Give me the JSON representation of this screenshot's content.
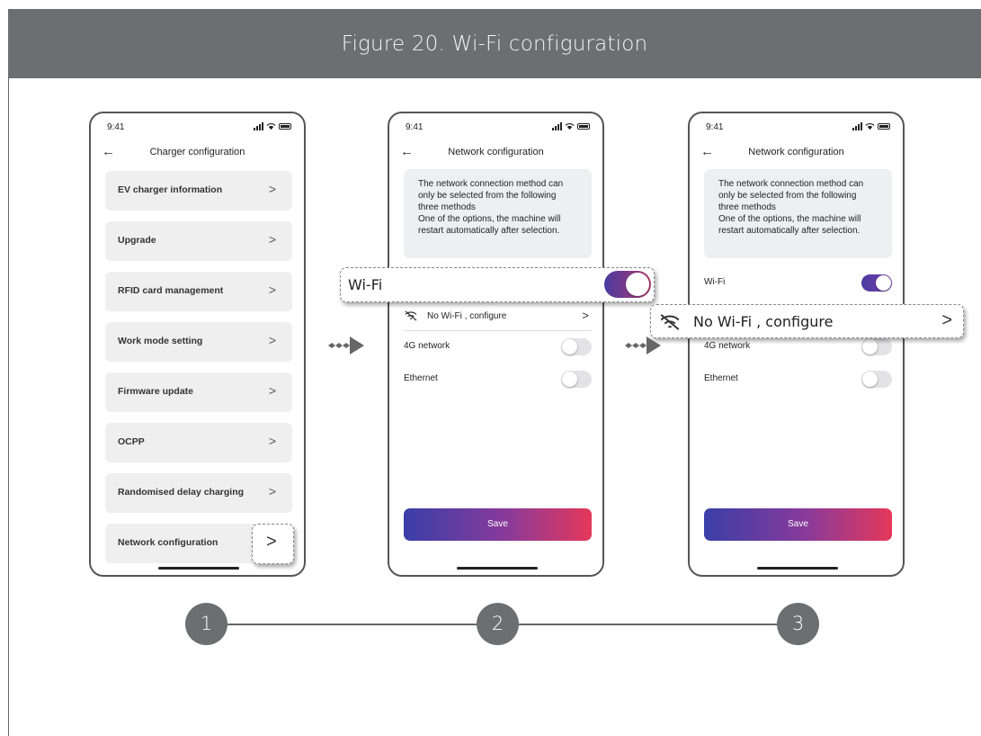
{
  "figure_title": "Figure 20.  Wi-Fi configuration",
  "status": {
    "time": "9:41"
  },
  "back_glyph": "←",
  "phone1": {
    "title": "Charger configuration",
    "items": [
      {
        "label": "EV charger information"
      },
      {
        "label": "Upgrade"
      },
      {
        "label": "RFID card management"
      },
      {
        "label": "Work mode setting"
      },
      {
        "label": "Firmware update"
      },
      {
        "label": "OCPP"
      },
      {
        "label": "Randomised delay charging"
      },
      {
        "label": "Network configuration"
      }
    ],
    "chevron": ">"
  },
  "network": {
    "title": "Network configuration",
    "info_lines": [
      "The network connection method can",
      "only be selected from the following",
      "three methods",
      "One of the options, the machine will",
      "restart automatically after selection."
    ],
    "wifi_label": "Wi-Fi",
    "no_wifi_label": "No Wi-Fi , configure",
    "fourg_label": "4G network",
    "ethernet_label": "Ethernet",
    "save_label": "Save",
    "wifi_on": true,
    "fourg_on": false,
    "ethernet_on": false
  },
  "callouts": {
    "chevron": ">",
    "wifi_label": "Wi-Fi",
    "no_wifi_label": "No Wi-Fi , configure",
    "no_wifi_chevron": ">"
  },
  "steps": [
    "1",
    "2",
    "3"
  ],
  "colors": {
    "banner": "#6d6e72",
    "toggle_on_start": "#4a3aa0",
    "save_gradient_end": "#e5385a"
  }
}
